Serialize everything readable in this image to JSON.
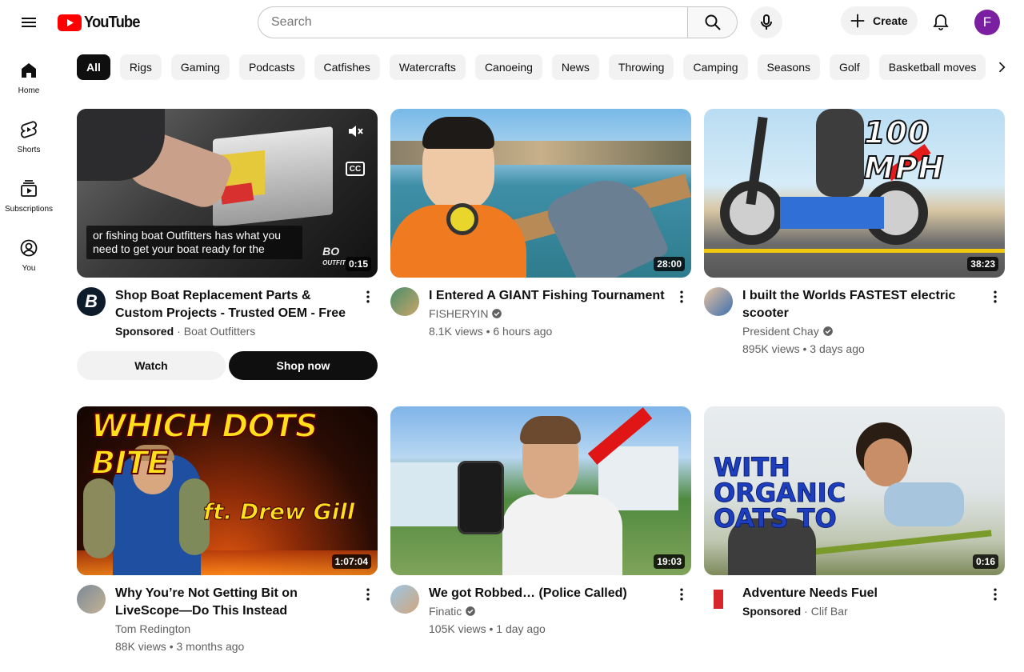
{
  "header": {
    "logo_text": "YouTube",
    "search_placeholder": "Search",
    "create_label": "Create",
    "avatar_letter": "F"
  },
  "sidebar": {
    "items": [
      {
        "label": "Home",
        "icon": "home-icon"
      },
      {
        "label": "Shorts",
        "icon": "shorts-icon"
      },
      {
        "label": "Subscriptions",
        "icon": "subscriptions-icon"
      },
      {
        "label": "You",
        "icon": "you-icon"
      }
    ]
  },
  "chips": [
    "All",
    "Rigs",
    "Gaming",
    "Podcasts",
    "Catfishes",
    "Watercrafts",
    "Canoeing",
    "News",
    "Throwing",
    "Camping",
    "Seasons",
    "Golf",
    "Basketball moves"
  ],
  "videos": [
    {
      "title": "Shop Boat Replacement Parts & Custom Projects - Trusted OEM - Free Shipping …",
      "sponsored_label": "Sponsored",
      "channel": "Boat Outfitters",
      "duration": "0:15",
      "caption": "or fishing boat Outfitters has what you need to get your boat ready for the",
      "watch_label": "Watch",
      "shop_label": "Shop now"
    },
    {
      "title": "I Entered A GIANT Fishing Tournament",
      "channel": "FISHERYIN",
      "stats": "8.1K views • 6 hours ago",
      "duration": "28:00"
    },
    {
      "title": "I built the Worlds FASTEST electric scooter",
      "channel": "President Chay",
      "stats": "895K views • 3 days ago",
      "duration": "38:23",
      "thumb_text": "100 MPH"
    },
    {
      "title": "Why You’re Not Getting Bit on LiveScope—Do This Instead",
      "channel": "Tom Redington",
      "stats": "88K views • 3 months ago",
      "duration": "1:07:04",
      "thumb_text": "WHICH DOTS BITE",
      "thumb_subtext": "ft. Drew Gill"
    },
    {
      "title": "We got Robbed… (Police Called)",
      "channel": "Finatic",
      "stats": "105K views • 1 day ago",
      "duration": "19:03"
    },
    {
      "title": "Adventure Needs Fuel",
      "sponsored_label": "Sponsored",
      "channel": "Clif Bar",
      "duration": "0:16",
      "thumb_text_lines": [
        "WITH",
        "ORGANIC",
        "OATS TO"
      ]
    }
  ],
  "colors": {
    "brand_red": "#ff0000",
    "avatar_purple": "#7b1fa2",
    "chip_bg": "#f2f2f2",
    "secondary_text": "#606060"
  }
}
